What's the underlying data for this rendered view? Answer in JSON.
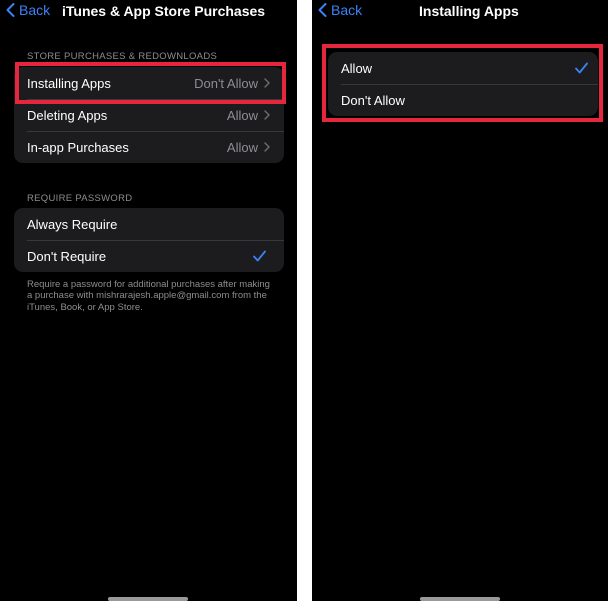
{
  "left_screen": {
    "nav": {
      "back_label": "Back",
      "title": "iTunes & App Store Purchases"
    },
    "store_section": {
      "header": "STORE PURCHASES & REDOWNLOADS",
      "rows": [
        {
          "label": "Installing Apps",
          "value": "Don't Allow"
        },
        {
          "label": "Deleting Apps",
          "value": "Allow"
        },
        {
          "label": "In-app Purchases",
          "value": "Allow"
        }
      ]
    },
    "password_section": {
      "header": "REQUIRE PASSWORD",
      "rows": [
        {
          "label": "Always Require",
          "selected": false
        },
        {
          "label": "Don't Require",
          "selected": true
        }
      ],
      "footnote": "Require a password for additional purchases after making a purchase with mishrarajesh.apple@gmail.com from the iTunes, Book, or App Store."
    }
  },
  "right_screen": {
    "nav": {
      "back_label": "Back",
      "title": "Installing Apps"
    },
    "options": [
      {
        "label": "Allow",
        "selected": true
      },
      {
        "label": "Don't Allow",
        "selected": false
      }
    ]
  },
  "colors": {
    "accent": "#3b82f6",
    "highlight": "#e5263d",
    "group_bg": "#1c1c1e",
    "secondary_text": "#8d8d92"
  }
}
